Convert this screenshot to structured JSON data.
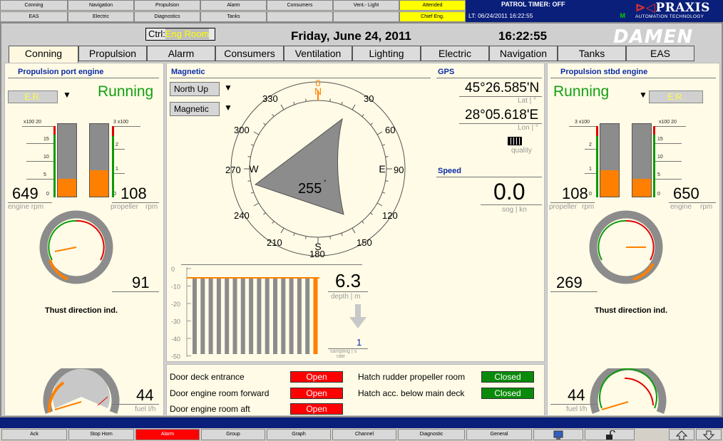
{
  "top_nav": {
    "row1": [
      "Conning",
      "Navigation",
      "Propulsion",
      "Alarm",
      "Consumers",
      "Vent.- Light",
      "Attended"
    ],
    "row2": [
      "EAS",
      "Electric",
      "Diagnostics",
      "Tanks",
      "",
      "",
      "Chief Eng."
    ]
  },
  "patrol": {
    "title": "PATROL TIMER: OFF",
    "lt": "LT: 06/24/2011  16:22:55",
    "mode": "M"
  },
  "brand": {
    "logo_a": "⊳◁",
    "logo_b": "PRAXIS",
    "sub": "AUTOMATION TECHNOLOGY",
    "damen": "DAMEN"
  },
  "header": {
    "ctrl_label": "Ctrl:",
    "ctrl_value": "Eng Room",
    "date": "Friday, June 24, 2011",
    "time": "16:22:55"
  },
  "tabs": [
    "Conning",
    "Propulsion",
    "Alarm",
    "Consumers",
    "Ventilation",
    "Lighting",
    "Electric",
    "Navigation",
    "Tanks",
    "EAS"
  ],
  "port": {
    "title": "Propulsion port engine",
    "er": "E.R.",
    "status": "Running",
    "rpm_scale_label": "x100  20",
    "rpm_ticks": [
      "15",
      "10",
      "5",
      "0"
    ],
    "prop_scale_label": "3  x100",
    "prop_ticks": [
      "2",
      "1",
      "0"
    ],
    "engine_rpm": "649",
    "propeller_rpm": "108",
    "engine_rpm_label": "engine rpm",
    "propeller_label": "propeller",
    "rpm_unit": "rpm",
    "engine_rpm_pct": 0.25,
    "prop_rpm_pct": 0.36,
    "thrust": "91",
    "thrust_label": "Thust direction ind.",
    "fuel": "44",
    "fuel_unit": "fuel l/h"
  },
  "stbd": {
    "title": "Propulsion stbd engine",
    "er": "E.R.",
    "status": "Running",
    "rpm_scale_label": "x100  20",
    "rpm_ticks": [
      "15",
      "10",
      "5",
      "0"
    ],
    "prop_scale_label": "3  x100",
    "prop_ticks": [
      "2",
      "1",
      "0"
    ],
    "engine_rpm": "650",
    "propeller_rpm": "108",
    "engine_rpm_label": "engine",
    "propeller_label": "propeller",
    "rpm_unit": "rpm",
    "engine_rpm_pct": 0.25,
    "prop_rpm_pct": 0.36,
    "thrust": "269",
    "thrust_label": "Thust direction ind.",
    "fuel": "44",
    "fuel_unit": "fuel l/h"
  },
  "magnetic": {
    "title": "Magnetic",
    "north_up": "North Up",
    "mode": "Magnetic",
    "heading": "255",
    "compass_labels": [
      "N",
      "E",
      "S",
      "W"
    ],
    "compass_numbers": [
      "30",
      "60",
      "120",
      "150",
      "180",
      "210",
      "240",
      "270",
      "300",
      "330",
      "0",
      "90"
    ]
  },
  "gps": {
    "title": "GPS",
    "lat": "45°26.585'N",
    "lat_label": "Lat | °",
    "lon": "28°05.618'E",
    "lon_label": "Lon | °",
    "quality": "quality"
  },
  "speed": {
    "title": "Speed",
    "value": "0.0",
    "unit": "sog | kn"
  },
  "depth": {
    "value": "6.3",
    "unit": "depth  | m",
    "sampling": "1",
    "sampling_label": "sampling | s",
    "sampling_label2": "rate",
    "ticks": [
      "0",
      "-10",
      "-20",
      "-30",
      "-40",
      "-50"
    ]
  },
  "doors": [
    {
      "label": "Door deck entrance",
      "status": "Open"
    },
    {
      "label": "Door engine room forward",
      "status": "Open"
    },
    {
      "label": "Door engine room aft",
      "status": "Open"
    }
  ],
  "hatches": [
    {
      "label": "Hatch rudder propeller room",
      "status": "Closed"
    },
    {
      "label": "Hatch acc. below main deck",
      "status": "Closed"
    }
  ],
  "bottom": [
    "Ack",
    "Stop Horn",
    "Alarm",
    "Group",
    "Graph",
    "Channel",
    "Diagnostic",
    "General"
  ],
  "colors": {
    "accent": "#0a1f7a",
    "running": "#13a013",
    "open": "#ff0000",
    "closed": "#0a8a0a",
    "bar": "#ff8000"
  }
}
